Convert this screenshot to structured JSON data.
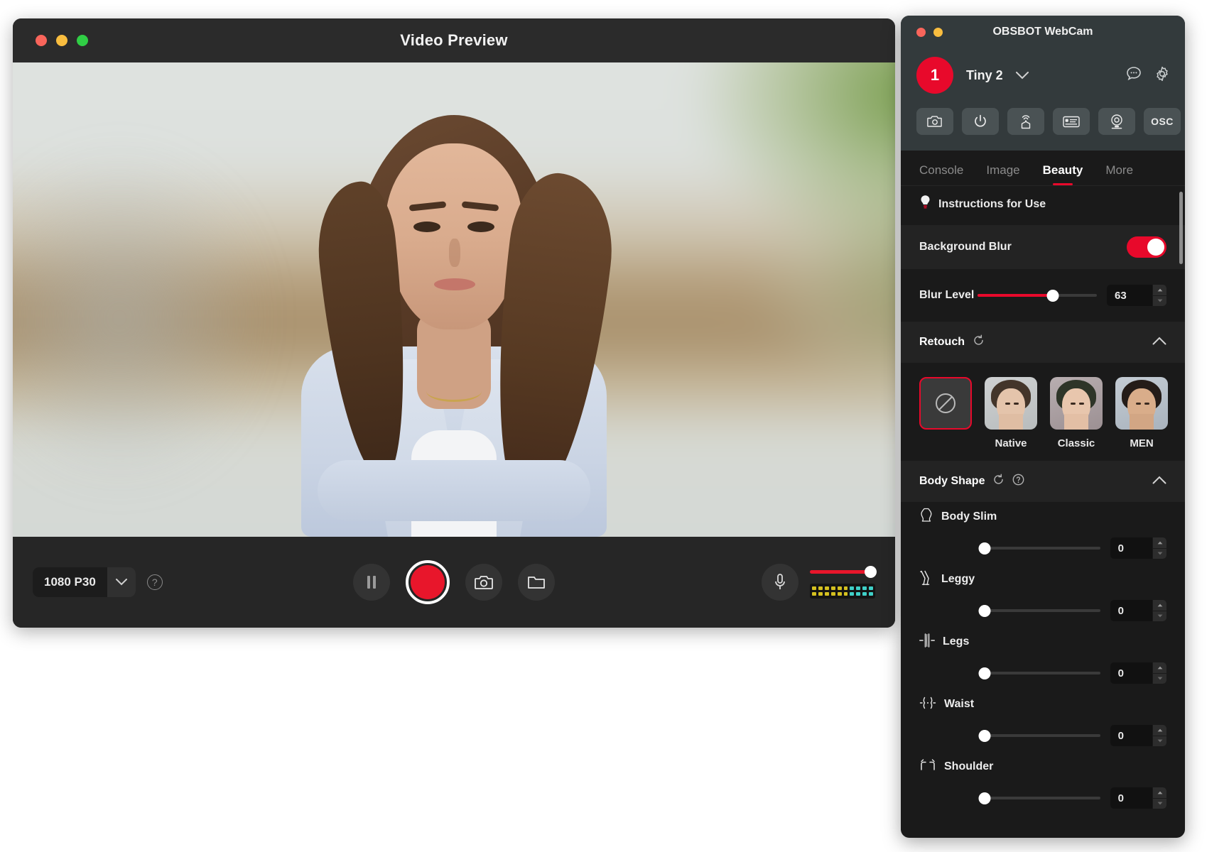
{
  "preview": {
    "title": "Video Preview",
    "traffic_lights": [
      "close",
      "minimize",
      "zoom"
    ],
    "resolution": "1080 P30",
    "help_icon": "question-mark-icon",
    "controls": [
      {
        "name": "pause-button",
        "icon": "pause-icon"
      },
      {
        "name": "record-button",
        "icon": "record-dot-icon"
      },
      {
        "name": "snapshot-button",
        "icon": "camera-icon"
      },
      {
        "name": "open-folder-button",
        "icon": "folder-icon"
      }
    ],
    "audio": {
      "mic_icon": "microphone-icon",
      "volume_value": 100,
      "meter_segments": 10
    }
  },
  "obsbot": {
    "window_title": "OBSBOT WebCam",
    "device_index": "1",
    "device_name": "Tiny 2",
    "device_caret_icon": "chevron-down-icon",
    "top_icons": [
      {
        "name": "chat-bubble-icon",
        "label": "chat"
      },
      {
        "name": "gear-icon",
        "label": "settings"
      }
    ],
    "toolbar": [
      {
        "name": "camera-icon",
        "label": ""
      },
      {
        "name": "power-icon",
        "label": ""
      },
      {
        "name": "gimbal-antenna-icon",
        "label": ""
      },
      {
        "name": "remote-control-icon",
        "label": ""
      },
      {
        "name": "webcam-icon",
        "label": ""
      },
      {
        "name": "osc-button",
        "label": "OSC"
      }
    ],
    "tabs": [
      {
        "label": "Console",
        "active": false
      },
      {
        "label": "Image",
        "active": false
      },
      {
        "label": "Beauty",
        "active": true
      },
      {
        "label": "More",
        "active": false
      }
    ],
    "instructions": {
      "icon": "lightbulb-icon",
      "label": "Instructions for Use"
    },
    "background_blur": {
      "label": "Background Blur",
      "enabled": true,
      "accent_color": "#e8092b"
    },
    "blur_level": {
      "label": "Blur Level",
      "value": "63",
      "percent": 63,
      "min": 0,
      "max": 100
    },
    "retouch": {
      "title": "Retouch",
      "reset_icon": "refresh-icon",
      "collapse_icon": "chevron-up-icon",
      "options": [
        {
          "label": "",
          "name": "retouch-none",
          "selected": true,
          "icon": "no-entry-icon"
        },
        {
          "label": "Native",
          "name": "retouch-native",
          "selected": false
        },
        {
          "label": "Classic",
          "name": "retouch-classic",
          "selected": false
        },
        {
          "label": "MEN",
          "name": "retouch-men",
          "selected": false
        }
      ]
    },
    "body_shape": {
      "title": "Body Shape",
      "reset_icon": "refresh-icon",
      "help_icon": "question-mark-icon",
      "collapse_icon": "chevron-up-icon",
      "sliders": [
        {
          "label": "Body Slim",
          "value": "0",
          "percent": 0,
          "icon": "body-slim-icon"
        },
        {
          "label": "Leggy",
          "value": "0",
          "percent": 0,
          "icon": "leggy-icon"
        },
        {
          "label": "Legs",
          "value": "0",
          "percent": 0,
          "icon": "legs-icon"
        },
        {
          "label": "Waist",
          "value": "0",
          "percent": 0,
          "icon": "waist-icon"
        },
        {
          "label": "Shoulder",
          "value": "0",
          "percent": 0,
          "icon": "shoulder-icon"
        }
      ]
    }
  }
}
